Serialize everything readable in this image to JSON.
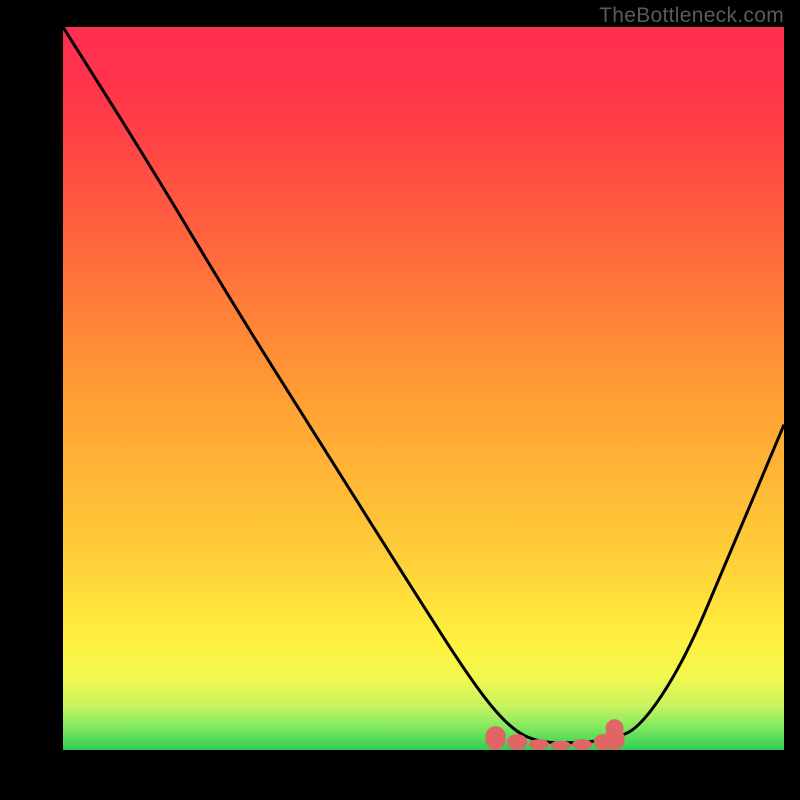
{
  "watermark": "TheBottleneck.com",
  "chart_data": {
    "type": "line",
    "title": "",
    "xlabel": "",
    "ylabel": "",
    "xlim": [
      0,
      100
    ],
    "ylim": [
      0,
      100
    ],
    "series": [
      {
        "name": "bottleneck-curve",
        "x": [
          0,
          12,
          24,
          36,
          48,
          57,
          62,
          66,
          72,
          76,
          80,
          86,
          92,
          100
        ],
        "values": [
          100,
          81,
          61,
          42,
          23,
          9,
          3,
          1,
          1,
          1.5,
          3,
          12,
          26,
          45
        ]
      }
    ],
    "highlight": {
      "name": "optimal-range",
      "x": [
        60,
        63,
        66,
        69,
        72,
        75,
        76.5
      ],
      "values": [
        3.3,
        2.2,
        1.5,
        1.3,
        1.5,
        2.2,
        3.0
      ],
      "bar_width": 2.8,
      "color": "#e06666"
    },
    "marker": {
      "x": 76.5,
      "y": 3.0,
      "color": "#e06666"
    }
  }
}
